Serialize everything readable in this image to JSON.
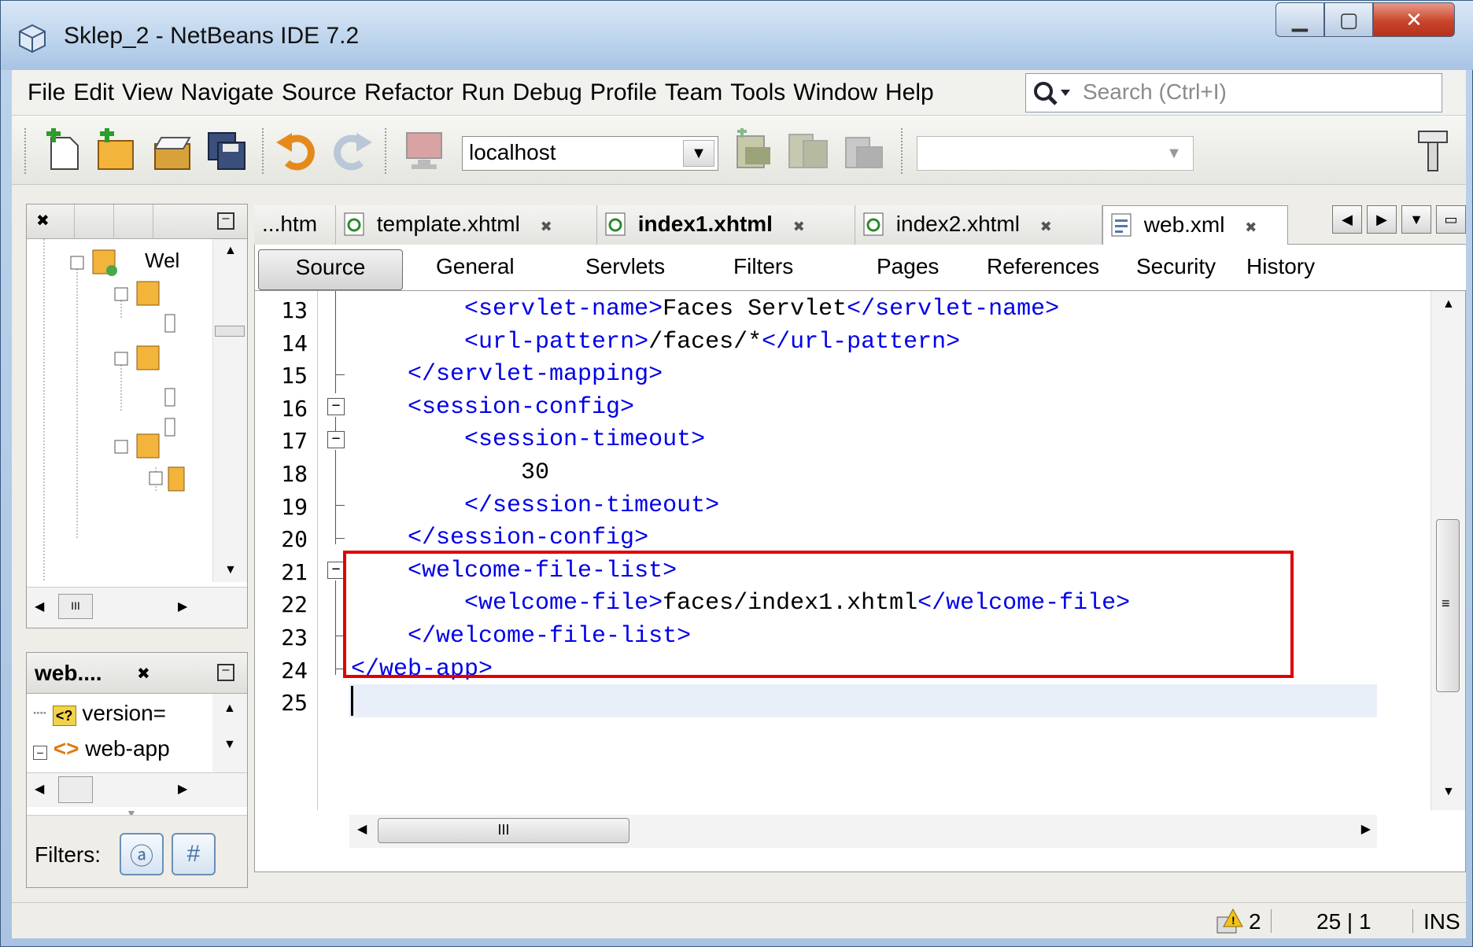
{
  "window": {
    "title": "Sklep_2 - NetBeans IDE 7.2"
  },
  "menu": [
    "File",
    "Edit",
    "View",
    "Navigate",
    "Source",
    "Refactor",
    "Run",
    "Debug",
    "Profile",
    "Team",
    "Tools",
    "Window",
    "Help"
  ],
  "search": {
    "placeholder": "Search (Ctrl+I)"
  },
  "toolbar": {
    "server": "localhost",
    "config": ""
  },
  "projects_panel": {
    "tree_label": "Wel"
  },
  "navigator": {
    "title": "web....",
    "items": [
      "version=",
      "web-app"
    ],
    "filters_label": "Filters:"
  },
  "editor_tabs": [
    {
      "label": "...htm",
      "active": false
    },
    {
      "label": "template.xhtml",
      "active": false
    },
    {
      "label": "index1.xhtml",
      "active": false,
      "bold": true
    },
    {
      "label": "index2.xhtml",
      "active": false
    },
    {
      "label": "web.xml",
      "active": true
    }
  ],
  "subtabs": [
    "Source",
    "General",
    "Servlets",
    "Filters",
    "Pages",
    "References",
    "Security",
    "History"
  ],
  "code": [
    {
      "line": "13",
      "indent": "        ",
      "parts": [
        [
          "tag",
          "<servlet-name>"
        ],
        [
          "txt",
          "Faces Servlet"
        ],
        [
          "tag",
          "</servlet-name>"
        ]
      ]
    },
    {
      "line": "14",
      "indent": "        ",
      "parts": [
        [
          "tag",
          "<url-pattern>"
        ],
        [
          "txt",
          "/faces/*"
        ],
        [
          "tag",
          "</url-pattern>"
        ]
      ]
    },
    {
      "line": "15",
      "indent": "    ",
      "parts": [
        [
          "tag",
          "</servlet-mapping>"
        ]
      ]
    },
    {
      "line": "16",
      "indent": "    ",
      "parts": [
        [
          "tag",
          "<session-config>"
        ]
      ]
    },
    {
      "line": "17",
      "indent": "        ",
      "parts": [
        [
          "tag",
          "<session-timeout>"
        ]
      ]
    },
    {
      "line": "18",
      "indent": "            ",
      "parts": [
        [
          "txt",
          "30"
        ]
      ]
    },
    {
      "line": "19",
      "indent": "        ",
      "parts": [
        [
          "tag",
          "</session-timeout>"
        ]
      ]
    },
    {
      "line": "20",
      "indent": "    ",
      "parts": [
        [
          "tag",
          "</session-config>"
        ]
      ]
    },
    {
      "line": "21",
      "indent": "    ",
      "parts": [
        [
          "tag",
          "<welcome-file-list>"
        ]
      ]
    },
    {
      "line": "22",
      "indent": "        ",
      "parts": [
        [
          "tag",
          "<welcome-file>"
        ],
        [
          "txt",
          "faces/index1.xhtml"
        ],
        [
          "tag",
          "</welcome-file>"
        ]
      ]
    },
    {
      "line": "23",
      "indent": "    ",
      "parts": [
        [
          "tag",
          "</welcome-file-list>"
        ]
      ]
    },
    {
      "line": "24",
      "indent": "",
      "parts": [
        [
          "tag",
          "</web-app>"
        ]
      ]
    },
    {
      "line": "25",
      "indent": "",
      "parts": []
    }
  ],
  "status": {
    "warnings": "2",
    "position": "25 | 1",
    "mode": "INS"
  },
  "colors": {
    "tag": "#0000e6",
    "highlight": "#e00000"
  }
}
